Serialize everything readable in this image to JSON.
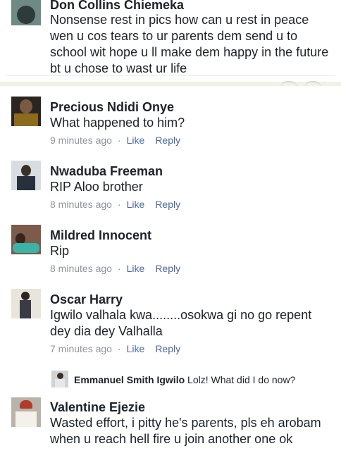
{
  "comments": [
    {
      "name": "Don Collins Chiemeka",
      "text": "Nonsense rest in pics how can u rest in peace wen u cos tears to ur parents dem send u to school wit hope u ll make dem happy in the future bt u chose to wast ur life"
    },
    {
      "name": "Precious Ndidi Onye",
      "text": "What happened to him?",
      "time": "9 minutes ago",
      "like": "Like",
      "reply": "Reply"
    },
    {
      "name": "Nwaduba Freeman",
      "text": "RIP Aloo brother",
      "time": "8 minutes ago",
      "like": "Like",
      "reply": "Reply"
    },
    {
      "name": "Mildred Innocent",
      "text": "Rip",
      "time": "8 minutes ago",
      "like": "Like",
      "reply": "Reply"
    },
    {
      "name": "Oscar Harry",
      "text": "Igwilo valhala kwa........osokwa gi no go repent dey dia dey Valhalla",
      "time": "7 minutes ago",
      "like": "Like",
      "reply": "Reply"
    },
    {
      "name": "Valentine Ejezie",
      "text": "Wasted effort, i pitty he's parents, pls eh arobam when u reach hell fire u join another one ok"
    }
  ],
  "reply": {
    "name": "Emmanuel Smith Igwilo",
    "text": "Lolz! What did I do now?"
  },
  "separator": "·",
  "colors": {
    "name_text": "#1d2129",
    "meta_text": "#90949c",
    "action_link": "#4b67a1",
    "divider": "#f2f1e6"
  }
}
